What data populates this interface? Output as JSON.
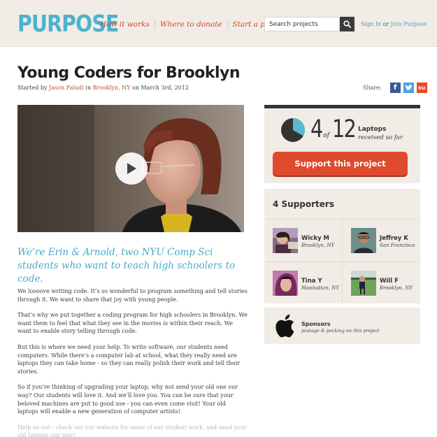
{
  "header": {
    "logo": "PURPOSE",
    "nav": [
      "How it works",
      "Where to donate",
      "Start a project"
    ],
    "search_placeholder": "Search projects",
    "sign_in": "Sign In",
    "or": "or",
    "join": "Join Purpose"
  },
  "project": {
    "title": "Young Coders for Brooklyn",
    "started_by_prefix": "Started by",
    "author": "Jason Faludi",
    "in_word": "in",
    "location": "Brooklyn, NY",
    "date_text": "on March 3rd, 2012",
    "share_label": "Share:",
    "share_buttons": [
      {
        "icon": "facebook-icon",
        "glyph": "f",
        "color": "#3b5998"
      },
      {
        "icon": "twitter-icon",
        "glyph": "t",
        "color": "#4aa3df"
      },
      {
        "icon": "stumbleupon-icon",
        "glyph": "su",
        "color": "#eb4823"
      }
    ],
    "tagline": "We’re Erin & Arnold, two NYU Comp Sci students who want to teach  high schoolers to code.",
    "paragraphs": [
      "We loooove writing code.  It’s so wonderful to program something and tell stories through it.  We want to share that joy with young people.",
      "That’s why we put together a coding program for high schoolers in Brooklyn.  We want them to feel that what they see in the movies is within their reach.  We want to enable story telling through code.",
      "But this is where we need your help.  To write software, our students need computers.  While there’s a computer lab at school, what they really need are laptops they can take home - so they can really polish their work and tell their stories.",
      "So if you’re thinking of upgrading your laptop, why not send your old one our way?  Our students will love it.  And we’ll love you.  You can be sure that your beloved machines are put to good use - you can even come visit!  Your old laptops will enable a new generation of computer artists!",
      "Help us out - check out our website for some of our student work, and send your old laptops our way!"
    ]
  },
  "progress": {
    "current": "4",
    "of": "of",
    "goal": "12",
    "fraction": 0.333,
    "unit": "Laptops",
    "suffix": "received so far",
    "pie_fill_color": "#5bb8d3",
    "pie_bg_color": "#333333"
  },
  "cta": {
    "label": "Support this project",
    "color": "#df4a2c"
  },
  "supporters": {
    "title": "4 Supporters",
    "list": [
      {
        "name": "Wicky M",
        "location": "Brooklyn, NY"
      },
      {
        "name": "Jeffrey K",
        "location": "San Francisco"
      },
      {
        "name": "Tina Y",
        "location": "Manhattan, NY"
      },
      {
        "name": "Will F",
        "location": "Brooklyn, NY"
      }
    ]
  },
  "sponsors": {
    "title": "Sponsors",
    "description": "postage & packing on this project",
    "logo_icon": "apple-logo-icon"
  }
}
